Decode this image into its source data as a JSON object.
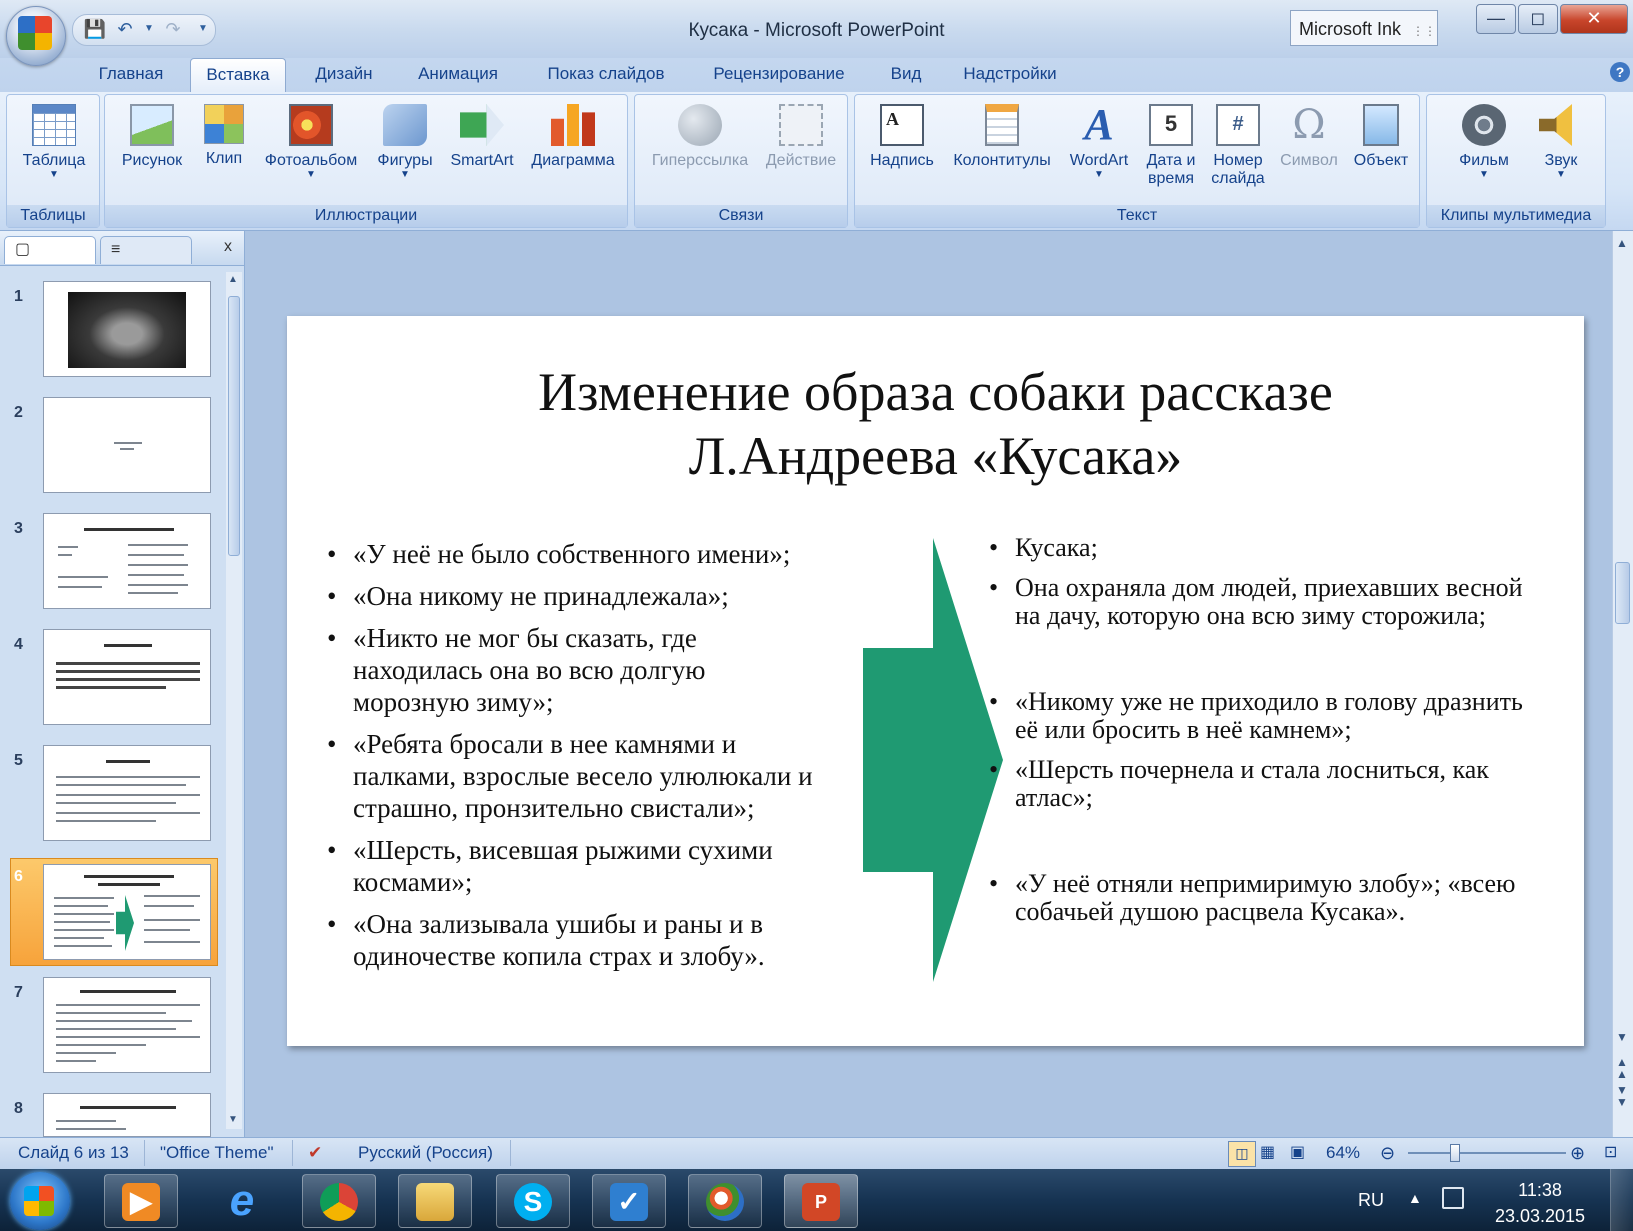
{
  "window": {
    "title": "Кусака - Microsoft PowerPoint",
    "ink_label": "Microsoft Ink"
  },
  "tabs": [
    "Главная",
    "Вставка",
    "Дизайн",
    "Анимация",
    "Показ слайдов",
    "Рецензирование",
    "Вид",
    "Надстройки"
  ],
  "active_tab": "Вставка",
  "ribbon": {
    "groups": {
      "tables": "Таблицы",
      "illustrations": "Иллюстрации",
      "links": "Связи",
      "text": "Текст",
      "media": "Клипы мультимедиа"
    },
    "buttons": {
      "table": "Таблица",
      "picture": "Рисунок",
      "clip": "Клип",
      "photo_album": "Фотоальбом",
      "shapes": "Фигуры",
      "smartart": "SmartArt",
      "chart": "Диаграмма",
      "hyperlink": "Гиперссылка",
      "action": "Действие",
      "textbox": "Надпись",
      "header_footer": "Колонтитулы",
      "wordart": "WordArt",
      "datetime_1": "Дата и",
      "datetime_2": "время",
      "slide_number_1": "Номер",
      "slide_number_2": "слайда",
      "symbol": "Символ",
      "object": "Объект",
      "movie": "Фильм",
      "sound": "Звук"
    }
  },
  "slides_panel": {
    "numbers": [
      "1",
      "2",
      "3",
      "4",
      "5",
      "6",
      "7",
      "8"
    ],
    "selected_index": 6,
    "close_label": "x"
  },
  "slide": {
    "title_line1": "Изменение образа собаки рассказе",
    "title_line2": "Л.Андреева «Кусака»",
    "left_bullets": [
      "«У неё не было собственного имени»;",
      "«Она никому не принадлежала»;",
      "«Никто не мог бы сказать, где находилась она во всю долгую морозную зиму»;",
      "«Ребята бросали в нее камнями и палками, взрослые весело улюлюкали и страшно, пронзительно свистали»;",
      "«Шерсть, висевшая рыжими сухими космами»;",
      "«Она зализывала ушибы и раны и в одиночестве копила страх и злобу»."
    ],
    "right_bullets": [
      "Кусака;",
      "Она охраняла дом людей, приехавших весной на дачу, которую она всю зиму сторожила;",
      " «Никому уже не приходило в голову дразнить её или бросить в неё камнем»;",
      "«Шерсть почернела и стала лосниться, как атлас»;",
      "«У неё отняли непримиримую злобу»; «всею собачьей душою расцвела Кусака»."
    ],
    "arrow_color": "#1f9a72"
  },
  "statusbar": {
    "slide_info": "Слайд 6 из 13",
    "theme": "\"Office Theme\"",
    "language": "Русский (Россия)",
    "zoom": "64%"
  },
  "taskbar": {
    "lang": "RU",
    "time": "11:38",
    "date": "23.03.2015"
  }
}
